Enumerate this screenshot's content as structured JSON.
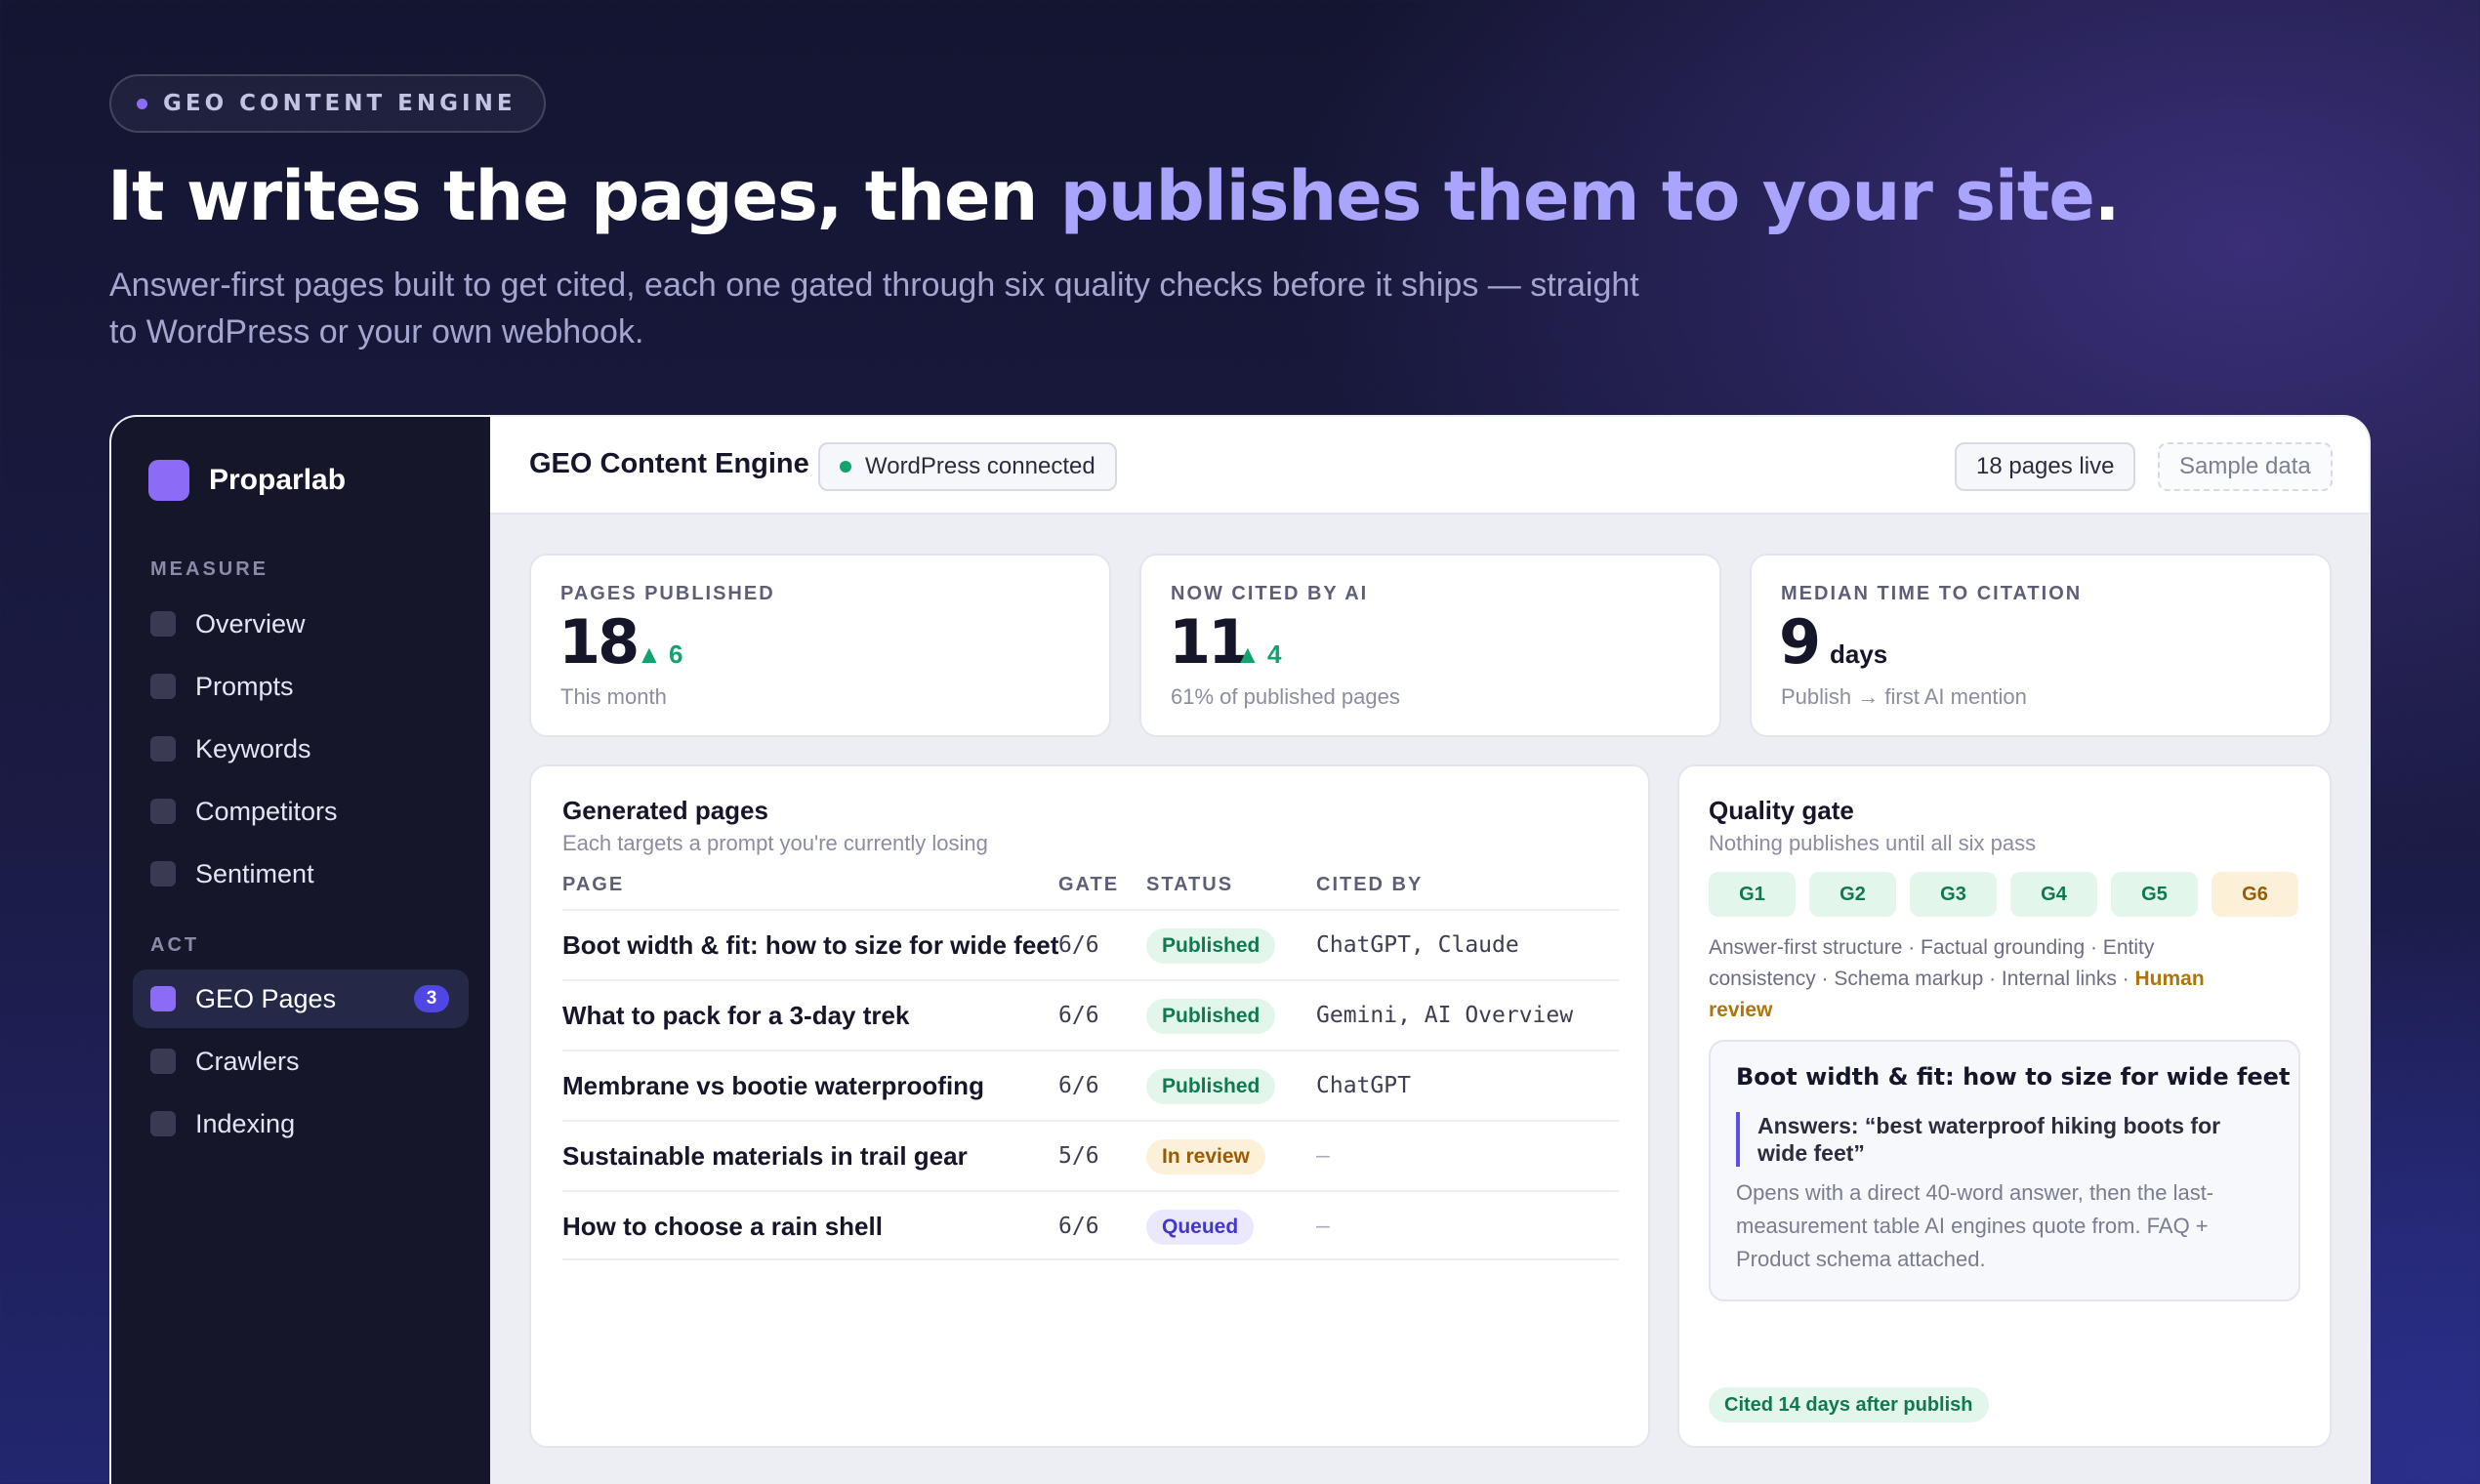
{
  "hero": {
    "eyebrow": "GEO CONTENT ENGINE",
    "headline_start": "It writes the pages, then ",
    "headline_highlight": "publishes them to your site",
    "headline_end": ".",
    "subhead": "Answer-first pages built to get cited, each one gated through six quality checks before it ships — straight to WordPress or your own webhook."
  },
  "sidebar": {
    "brand": "Proparlab",
    "sections": [
      {
        "label": "MEASURE",
        "items": [
          {
            "label": "Overview"
          },
          {
            "label": "Prompts"
          },
          {
            "label": "Keywords"
          },
          {
            "label": "Competitors"
          },
          {
            "label": "Sentiment"
          }
        ]
      },
      {
        "label": "ACT",
        "items": [
          {
            "label": "GEO Pages",
            "badge": "3",
            "active": true
          },
          {
            "label": "Crawlers"
          },
          {
            "label": "Indexing"
          }
        ]
      }
    ]
  },
  "topbar": {
    "title": "GEO Content Engine",
    "connection": "WordPress connected",
    "pages_live": "18 pages live",
    "sample": "Sample data"
  },
  "stats": [
    {
      "label": "PAGES PUBLISHED",
      "value": "18",
      "delta": "▲ 6",
      "foot": "This month"
    },
    {
      "label": "NOW CITED BY AI",
      "value": "11",
      "delta": "▲ 4",
      "foot": "61% of published pages"
    },
    {
      "label": "MEDIAN TIME TO CITATION",
      "value": "9",
      "unit": "days",
      "foot": "Publish → first AI mention"
    }
  ],
  "pages_table": {
    "title": "Generated pages",
    "subtitle": "Each targets a prompt you're currently losing",
    "columns": [
      "PAGE",
      "GATE",
      "STATUS",
      "CITED BY"
    ],
    "rows": [
      {
        "page": "Boot width & fit: how to size for wide feet",
        "gate": "6/6",
        "status": "Published",
        "cited_by": "ChatGPT, Claude"
      },
      {
        "page": "What to pack for a 3-day trek",
        "gate": "6/6",
        "status": "Published",
        "cited_by": "Gemini, AI Overview"
      },
      {
        "page": "Membrane vs bootie waterproofing",
        "gate": "6/6",
        "status": "Published",
        "cited_by": "ChatGPT"
      },
      {
        "page": "Sustainable materials in trail gear",
        "gate": "5/6",
        "status": "In review",
        "cited_by": "—"
      },
      {
        "page": "How to choose a rain shell",
        "gate": "6/6",
        "status": "Queued",
        "cited_by": "—"
      }
    ]
  },
  "quality_gate": {
    "title": "Quality gate",
    "subtitle": "Nothing publishes until all six pass",
    "gates": [
      "G1",
      "G2",
      "G3",
      "G4",
      "G5",
      "G6"
    ],
    "checks_text": "Answer-first structure · Factual grounding · Entity consistency · Schema markup · Internal links · ",
    "human_review": "Human review",
    "preview": {
      "title": "Boot width & fit: how to size for wide feet",
      "answers": "Answers: “best waterproof hiking boots for wide feet”",
      "body": "Opens with a direct 40-word answer, then the last-measurement table AI engines quote from. FAQ + Product schema attached."
    },
    "cited_note": "Cited 14 days after publish"
  },
  "colors": {
    "accent": "#8b6cf6",
    "highlight": "#a9a5ff",
    "success": "#10a36c",
    "warning": "#9a5b05",
    "queued": "#4338ca"
  }
}
